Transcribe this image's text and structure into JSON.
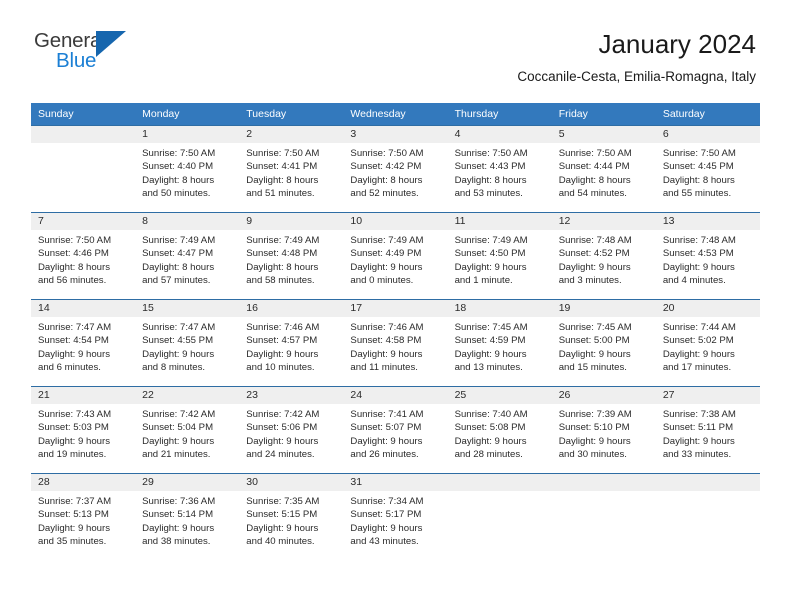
{
  "brand": {
    "name_part1": "General",
    "name_part2": "Blue"
  },
  "header": {
    "title": "January 2024",
    "location": "Coccanile-Cesta, Emilia-Romagna, Italy"
  },
  "colors": {
    "header_blue": "#3379bd",
    "row_border_blue": "#2e6da4",
    "daynum_band": "#efefef",
    "brand_blue": "#1b7fd4",
    "brand_dark": "#3b3b3b"
  },
  "weekdays": [
    "Sunday",
    "Monday",
    "Tuesday",
    "Wednesday",
    "Thursday",
    "Friday",
    "Saturday"
  ],
  "weeks": [
    [
      {
        "day": "",
        "lines": []
      },
      {
        "day": "1",
        "lines": [
          "Sunrise: 7:50 AM",
          "Sunset: 4:40 PM",
          "Daylight: 8 hours",
          "and 50 minutes."
        ]
      },
      {
        "day": "2",
        "lines": [
          "Sunrise: 7:50 AM",
          "Sunset: 4:41 PM",
          "Daylight: 8 hours",
          "and 51 minutes."
        ]
      },
      {
        "day": "3",
        "lines": [
          "Sunrise: 7:50 AM",
          "Sunset: 4:42 PM",
          "Daylight: 8 hours",
          "and 52 minutes."
        ]
      },
      {
        "day": "4",
        "lines": [
          "Sunrise: 7:50 AM",
          "Sunset: 4:43 PM",
          "Daylight: 8 hours",
          "and 53 minutes."
        ]
      },
      {
        "day": "5",
        "lines": [
          "Sunrise: 7:50 AM",
          "Sunset: 4:44 PM",
          "Daylight: 8 hours",
          "and 54 minutes."
        ]
      },
      {
        "day": "6",
        "lines": [
          "Sunrise: 7:50 AM",
          "Sunset: 4:45 PM",
          "Daylight: 8 hours",
          "and 55 minutes."
        ]
      }
    ],
    [
      {
        "day": "7",
        "lines": [
          "Sunrise: 7:50 AM",
          "Sunset: 4:46 PM",
          "Daylight: 8 hours",
          "and 56 minutes."
        ]
      },
      {
        "day": "8",
        "lines": [
          "Sunrise: 7:49 AM",
          "Sunset: 4:47 PM",
          "Daylight: 8 hours",
          "and 57 minutes."
        ]
      },
      {
        "day": "9",
        "lines": [
          "Sunrise: 7:49 AM",
          "Sunset: 4:48 PM",
          "Daylight: 8 hours",
          "and 58 minutes."
        ]
      },
      {
        "day": "10",
        "lines": [
          "Sunrise: 7:49 AM",
          "Sunset: 4:49 PM",
          "Daylight: 9 hours",
          "and 0 minutes."
        ]
      },
      {
        "day": "11",
        "lines": [
          "Sunrise: 7:49 AM",
          "Sunset: 4:50 PM",
          "Daylight: 9 hours",
          "and 1 minute."
        ]
      },
      {
        "day": "12",
        "lines": [
          "Sunrise: 7:48 AM",
          "Sunset: 4:52 PM",
          "Daylight: 9 hours",
          "and 3 minutes."
        ]
      },
      {
        "day": "13",
        "lines": [
          "Sunrise: 7:48 AM",
          "Sunset: 4:53 PM",
          "Daylight: 9 hours",
          "and 4 minutes."
        ]
      }
    ],
    [
      {
        "day": "14",
        "lines": [
          "Sunrise: 7:47 AM",
          "Sunset: 4:54 PM",
          "Daylight: 9 hours",
          "and 6 minutes."
        ]
      },
      {
        "day": "15",
        "lines": [
          "Sunrise: 7:47 AM",
          "Sunset: 4:55 PM",
          "Daylight: 9 hours",
          "and 8 minutes."
        ]
      },
      {
        "day": "16",
        "lines": [
          "Sunrise: 7:46 AM",
          "Sunset: 4:57 PM",
          "Daylight: 9 hours",
          "and 10 minutes."
        ]
      },
      {
        "day": "17",
        "lines": [
          "Sunrise: 7:46 AM",
          "Sunset: 4:58 PM",
          "Daylight: 9 hours",
          "and 11 minutes."
        ]
      },
      {
        "day": "18",
        "lines": [
          "Sunrise: 7:45 AM",
          "Sunset: 4:59 PM",
          "Daylight: 9 hours",
          "and 13 minutes."
        ]
      },
      {
        "day": "19",
        "lines": [
          "Sunrise: 7:45 AM",
          "Sunset: 5:00 PM",
          "Daylight: 9 hours",
          "and 15 minutes."
        ]
      },
      {
        "day": "20",
        "lines": [
          "Sunrise: 7:44 AM",
          "Sunset: 5:02 PM",
          "Daylight: 9 hours",
          "and 17 minutes."
        ]
      }
    ],
    [
      {
        "day": "21",
        "lines": [
          "Sunrise: 7:43 AM",
          "Sunset: 5:03 PM",
          "Daylight: 9 hours",
          "and 19 minutes."
        ]
      },
      {
        "day": "22",
        "lines": [
          "Sunrise: 7:42 AM",
          "Sunset: 5:04 PM",
          "Daylight: 9 hours",
          "and 21 minutes."
        ]
      },
      {
        "day": "23",
        "lines": [
          "Sunrise: 7:42 AM",
          "Sunset: 5:06 PM",
          "Daylight: 9 hours",
          "and 24 minutes."
        ]
      },
      {
        "day": "24",
        "lines": [
          "Sunrise: 7:41 AM",
          "Sunset: 5:07 PM",
          "Daylight: 9 hours",
          "and 26 minutes."
        ]
      },
      {
        "day": "25",
        "lines": [
          "Sunrise: 7:40 AM",
          "Sunset: 5:08 PM",
          "Daylight: 9 hours",
          "and 28 minutes."
        ]
      },
      {
        "day": "26",
        "lines": [
          "Sunrise: 7:39 AM",
          "Sunset: 5:10 PM",
          "Daylight: 9 hours",
          "and 30 minutes."
        ]
      },
      {
        "day": "27",
        "lines": [
          "Sunrise: 7:38 AM",
          "Sunset: 5:11 PM",
          "Daylight: 9 hours",
          "and 33 minutes."
        ]
      }
    ],
    [
      {
        "day": "28",
        "lines": [
          "Sunrise: 7:37 AM",
          "Sunset: 5:13 PM",
          "Daylight: 9 hours",
          "and 35 minutes."
        ]
      },
      {
        "day": "29",
        "lines": [
          "Sunrise: 7:36 AM",
          "Sunset: 5:14 PM",
          "Daylight: 9 hours",
          "and 38 minutes."
        ]
      },
      {
        "day": "30",
        "lines": [
          "Sunrise: 7:35 AM",
          "Sunset: 5:15 PM",
          "Daylight: 9 hours",
          "and 40 minutes."
        ]
      },
      {
        "day": "31",
        "lines": [
          "Sunrise: 7:34 AM",
          "Sunset: 5:17 PM",
          "Daylight: 9 hours",
          "and 43 minutes."
        ]
      },
      {
        "day": "",
        "lines": []
      },
      {
        "day": "",
        "lines": []
      },
      {
        "day": "",
        "lines": []
      }
    ]
  ]
}
